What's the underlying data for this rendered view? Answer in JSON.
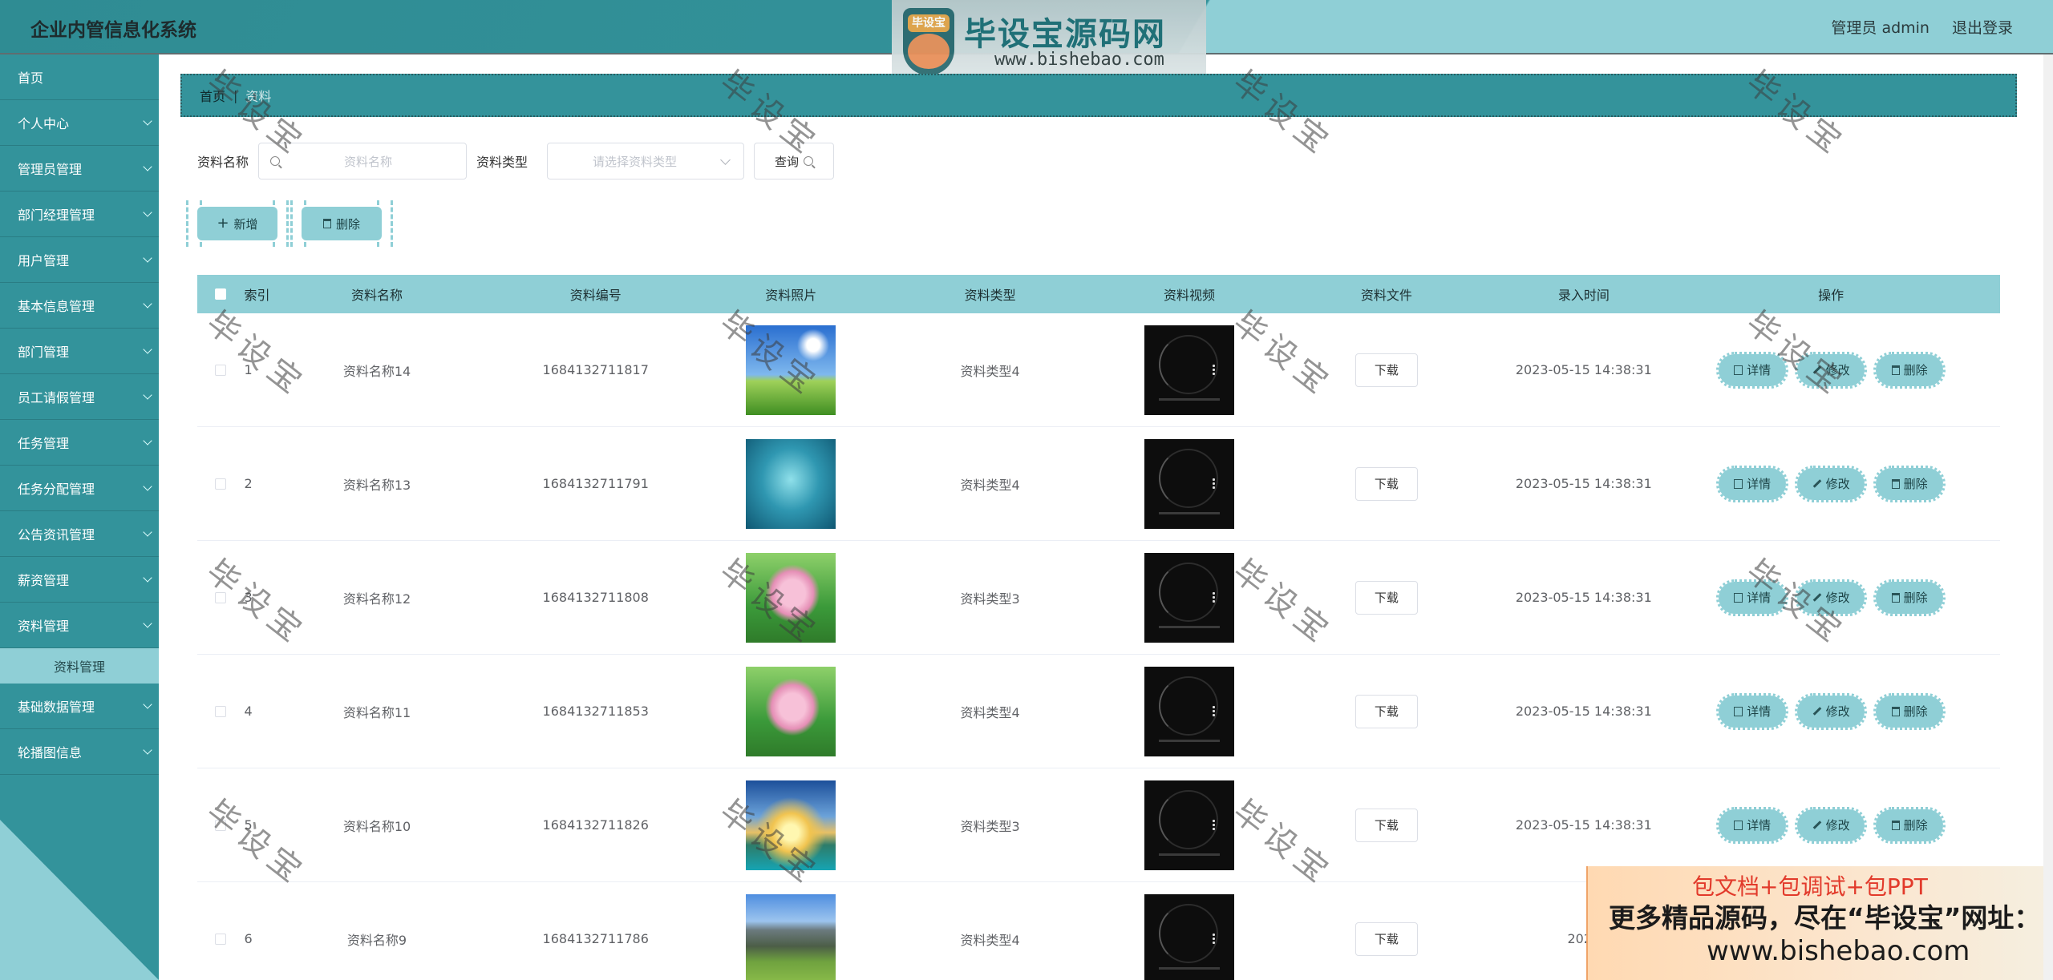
{
  "app": {
    "title": "企业内管信息化系统",
    "user_label": "管理员 admin",
    "logout_label": "退出登录"
  },
  "logo": {
    "badge": "毕设宝",
    "name": "毕设宝源码网",
    "url": "www.bishebao.com"
  },
  "sidebar": {
    "items": [
      {
        "label": "首页",
        "expandable": false
      },
      {
        "label": "个人中心",
        "expandable": true
      },
      {
        "label": "管理员管理",
        "expandable": true
      },
      {
        "label": "部门经理管理",
        "expandable": true
      },
      {
        "label": "用户管理",
        "expandable": true
      },
      {
        "label": "基本信息管理",
        "expandable": true
      },
      {
        "label": "部门管理",
        "expandable": true
      },
      {
        "label": "员工请假管理",
        "expandable": true
      },
      {
        "label": "任务管理",
        "expandable": true
      },
      {
        "label": "任务分配管理",
        "expandable": true
      },
      {
        "label": "公告资讯管理",
        "expandable": true
      },
      {
        "label": "薪资管理",
        "expandable": true
      },
      {
        "label": "资料管理",
        "expandable": true
      }
    ],
    "sub_active": "资料管理",
    "items_after": [
      {
        "label": "基础数据管理",
        "expandable": true
      },
      {
        "label": "轮播图信息",
        "expandable": true
      }
    ]
  },
  "breadcrumb": {
    "home": "首页",
    "current": "资料"
  },
  "search": {
    "name_label": "资料名称",
    "name_placeholder": "资料名称",
    "type_label": "资料类型",
    "type_placeholder": "请选择资料类型",
    "query_label": "查询"
  },
  "actions": {
    "add_label": "新增",
    "delete_label": "删除"
  },
  "table": {
    "headers": {
      "index": "索引",
      "name": "资料名称",
      "code": "资料编号",
      "photo": "资料照片",
      "type": "资料类型",
      "video": "资料视频",
      "file": "资料文件",
      "time": "录入时间",
      "op": "操作"
    },
    "download_label": "下载",
    "op_labels": {
      "detail": "详情",
      "edit": "修改",
      "delete": "删除"
    },
    "rows": [
      {
        "index": "1",
        "name": "资料名称14",
        "code": "1684132711817",
        "type": "资料类型4",
        "time": "2023-05-15 14:38:31",
        "photo": "sky-meadow"
      },
      {
        "index": "2",
        "name": "资料名称13",
        "code": "1684132711791",
        "type": "资料类型4",
        "time": "2023-05-15 14:38:31",
        "photo": "heart-water"
      },
      {
        "index": "3",
        "name": "资料名称12",
        "code": "1684132711808",
        "type": "资料类型3",
        "time": "2023-05-15 14:38:31",
        "photo": "lotus"
      },
      {
        "index": "4",
        "name": "资料名称11",
        "code": "1684132711853",
        "type": "资料类型4",
        "time": "2023-05-15 14:38:31",
        "photo": "lotus"
      },
      {
        "index": "5",
        "name": "资料名称10",
        "code": "1684132711826",
        "type": "资料类型3",
        "time": "2023-05-15 14:38:31",
        "photo": "sunset-lake"
      },
      {
        "index": "6",
        "name": "资料名称9",
        "code": "1684132711786",
        "type": "资料类型4",
        "time": "2023",
        "photo": "mountain-field"
      }
    ]
  },
  "watermark_text": "毕设宝",
  "promo": {
    "line1": "包文档+包调试+包PPT",
    "line2": "更多精品源码，尽在“毕设宝”网址：",
    "line3": "www.bishebao.com"
  },
  "colors": {
    "primary": "#33939b",
    "accent_light": "#8fcfd6",
    "promo_red": "#e23a2b"
  }
}
